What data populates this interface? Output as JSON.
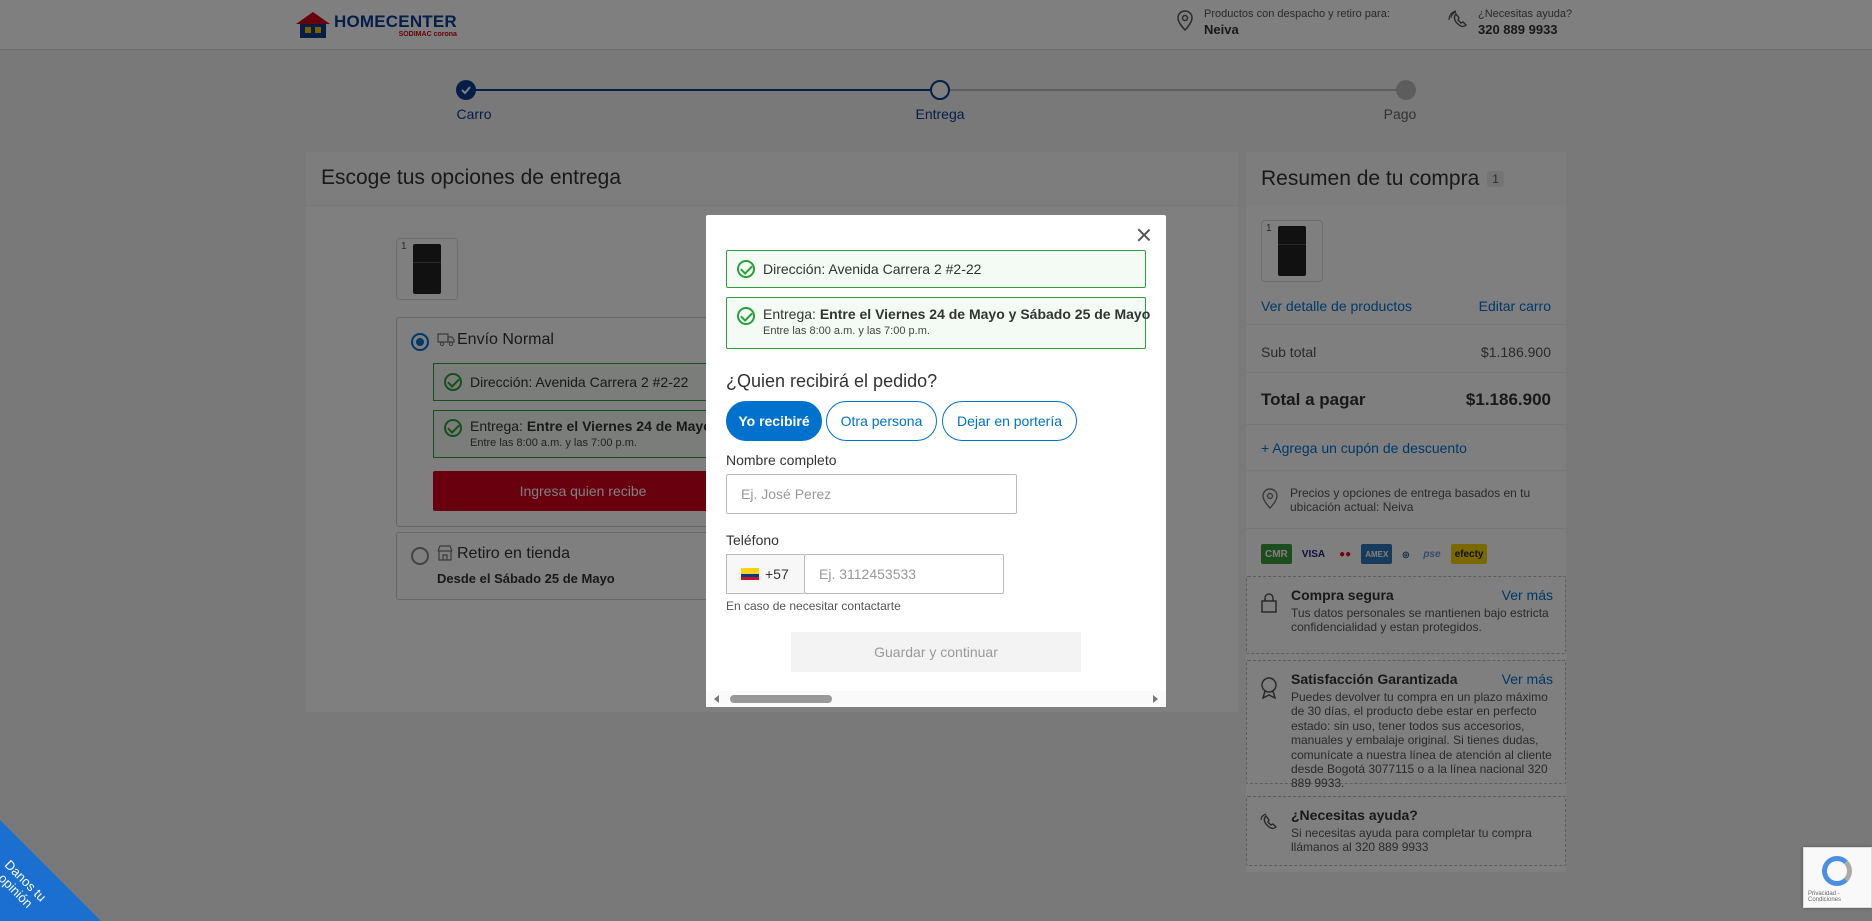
{
  "header": {
    "logo_main": "HOMECENTER",
    "logo_sub": "SODIMAC corona",
    "location_label": "Productos con despacho y retiro para:",
    "location_city": "Neiva",
    "help_label": "¿Necesitas ayuda?",
    "help_phone": "320 889 9933"
  },
  "stepper": {
    "steps": [
      {
        "label": "Carro",
        "state": "done"
      },
      {
        "label": "Entrega",
        "state": "current"
      },
      {
        "label": "Pago",
        "state": "pending"
      }
    ]
  },
  "delivery": {
    "title": "Escoge tus opciones de entrega",
    "product_qty": "1",
    "shipping_option": {
      "label": "Envío Normal",
      "address_prefix": "Dirección:",
      "address": "Avenida Carrera 2 #2-22",
      "delivery_prefix": "Entrega:",
      "delivery_window": "Entre el Viernes 24 de Mayo y",
      "delivery_hours": "Entre las 8:00 a.m. y las 7:00 p.m.",
      "cta": "Ingresa quien recibe"
    },
    "pickup_option": {
      "label": "Retiro en tienda",
      "date": "Desde el Sábado 25 de Mayo"
    }
  },
  "summary": {
    "title": "Resumen de tu compra",
    "count": "1",
    "product_qty": "1",
    "view_details": "Ver detalle de productos",
    "edit_cart": "Editar carro",
    "subtotal_label": "Sub total",
    "subtotal_value": "$1.186.900",
    "total_label": "Total a pagar",
    "total_value": "$1.186.900",
    "coupon": "+ Agrega un cupón de descuento",
    "location_note": "Precios y opciones de entrega basados en tu ubicación actual: Neiva",
    "payment_methods": [
      "CMR",
      "VISA",
      "MC",
      "AMEX",
      "DINERS",
      "pse",
      "efecty"
    ],
    "secure_title": "Compra segura",
    "secure_more": "Ver más",
    "secure_desc": "Tus datos personales se mantienen bajo estricta confidencialidad y estan protegidos.",
    "guarantee_title": "Satisfacción Garantizada",
    "guarantee_more": "Ver más",
    "guarantee_desc": "Puedes devolver tu compra en un plazo máximo de 30 días, el producto debe estar en perfecto estado: sin uso, tener todos sus accesorios, manuales y embalaje original. Si tienes dudas, comunícate a nuestra línea de atención al cliente desde Bogotá 3077115 o a la línea nacional 320 889 9933.",
    "help_title": "¿Necesitas ayuda?",
    "help_desc": "Si necesitas ayuda para completar tu compra llámanos al 320 889 9933"
  },
  "modal": {
    "address_prefix": "Dirección:",
    "address": "Avenida Carrera 2 #2-22",
    "delivery_prefix": "Entrega:",
    "delivery_window": "Entre el Viernes 24 de Mayo y Sábado 25 de Mayo",
    "delivery_hours": "Entre las 8:00 a.m. y las 7:00 p.m.",
    "question": "¿Quien recibirá el pedido?",
    "options": [
      {
        "label": "Yo recibiré",
        "active": true
      },
      {
        "label": "Otra persona",
        "active": false
      },
      {
        "label": "Dejar en portería",
        "active": false
      }
    ],
    "name_label": "Nombre completo",
    "name_placeholder": "Ej. José Perez",
    "phone_label": "Teléfono",
    "phone_prefix": "+57",
    "phone_placeholder": "Ej. 3112453533",
    "phone_hint": "En caso de necesitar contactarte",
    "submit": "Guardar y continuar"
  },
  "feedback": {
    "label": "Danos tu opinión"
  },
  "recaptcha": {
    "text": "Privacidad - Condiciones"
  },
  "colors": {
    "brand_blue": "#0072ce",
    "brand_red": "#d0021b",
    "success_green": "#2d9e3a"
  }
}
